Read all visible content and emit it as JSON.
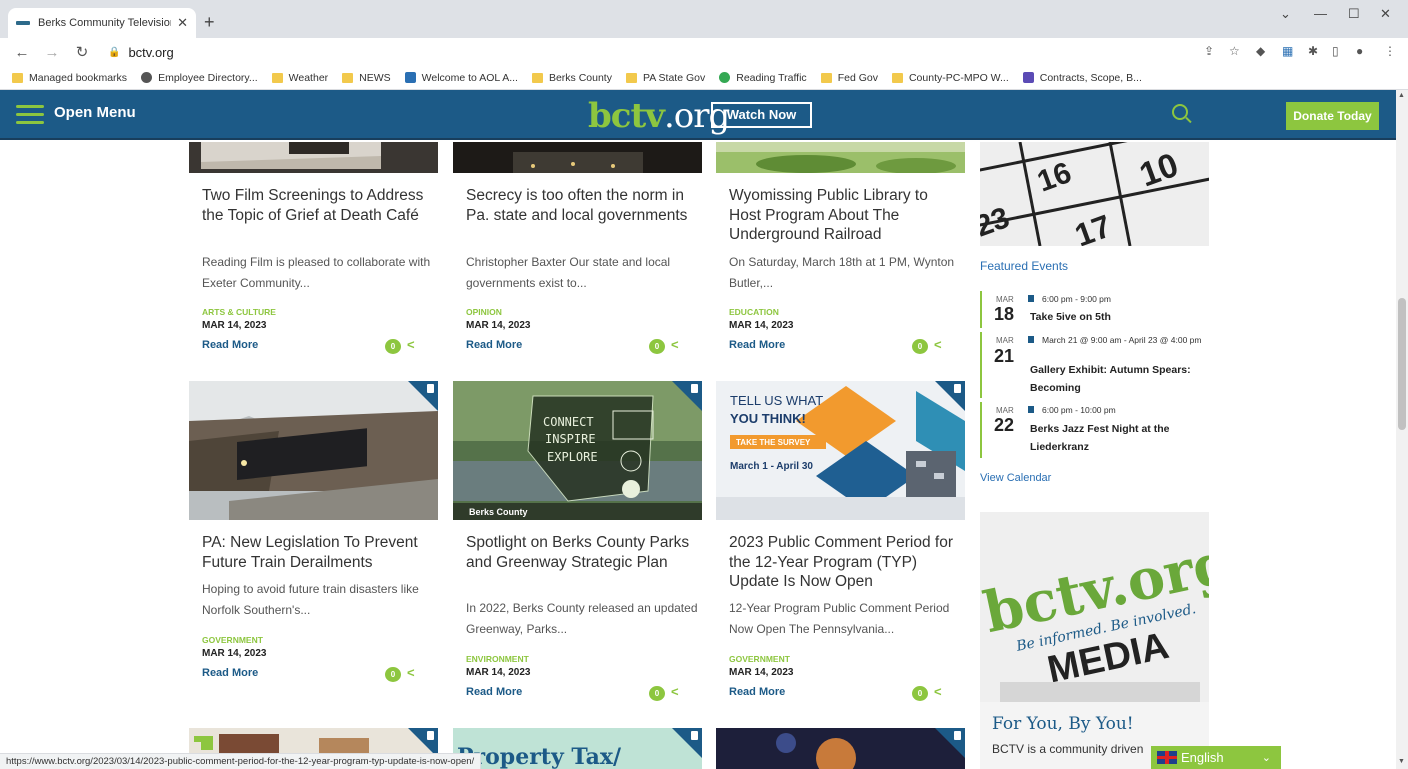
{
  "browser": {
    "tab_title": "Berks Community Television | Be",
    "url": "bctv.org",
    "bookmarks": [
      {
        "label": "Managed bookmarks",
        "type": "folder"
      },
      {
        "label": "Employee Directory...",
        "type": "site"
      },
      {
        "label": "Weather",
        "type": "folder"
      },
      {
        "label": "NEWS",
        "type": "folder"
      },
      {
        "label": "Welcome to AOL A...",
        "type": "site"
      },
      {
        "label": "Berks County",
        "type": "folder"
      },
      {
        "label": "PA State Gov",
        "type": "folder"
      },
      {
        "label": "Reading Traffic",
        "type": "site"
      },
      {
        "label": "Fed Gov",
        "type": "folder"
      },
      {
        "label": "County-PC-MPO W...",
        "type": "folder"
      },
      {
        "label": "Contracts, Scope, B...",
        "type": "site"
      }
    ],
    "status_url": "https://www.bctv.org/2023/03/14/2023-public-comment-period-for-the-12-year-program-typ-update-is-now-open/"
  },
  "header": {
    "menu_label": "Open Menu",
    "logo_main": "bctv",
    "logo_suffix": ".org",
    "watch_now": "Watch Now",
    "donate": "Donate Today"
  },
  "articles": [
    {
      "title": "Two Film Screenings to Address the Topic of Grief at Death Café",
      "excerpt": "Reading Film is pleased to collaborate with Exeter Community...",
      "category": "ARTS & CULTURE",
      "date": "MAR 14, 2023",
      "read_more": "Read More",
      "comments": "0"
    },
    {
      "title": "Secrecy is too often the norm in Pa. state and local governments",
      "excerpt": "Christopher Baxter Our state and local governments exist to...",
      "category": "OPINION",
      "date": "MAR 14, 2023",
      "read_more": "Read More",
      "comments": "0"
    },
    {
      "title": "Wyomissing Public Library to Host Program About The Underground Railroad",
      "excerpt": "On Saturday, March 18th at 1 PM, Wynton Butler,...",
      "category": "EDUCATION",
      "date": "MAR 14, 2023",
      "read_more": "Read More",
      "comments": "0"
    },
    {
      "title": "PA: New Legislation To Prevent Future Train Derailments",
      "excerpt": "Hoping to avoid future train disasters like Norfolk Southern's...",
      "category": "GOVERNMENT",
      "date": "MAR 14, 2023",
      "read_more": "Read More",
      "comments": "0"
    },
    {
      "title": "Spotlight on Berks County Parks and Greenway Strategic Plan",
      "excerpt": "In 2022, Berks County released an updated Greenway, Parks...",
      "category": "ENVIRONMENT",
      "date": "MAR 14, 2023",
      "read_more": "Read More",
      "comments": "0",
      "image_text": [
        "CONNECT",
        "INSPIRE",
        "EXPLORE",
        "Berks County"
      ]
    },
    {
      "title": "2023 Public Comment Period for the 12-Year Program (TYP) Update Is Now Open",
      "excerpt": "12-Year Program Public Comment Period Now Open The Pennsylvania...",
      "category": "GOVERNMENT",
      "date": "MAR 14, 2023",
      "read_more": "Read More",
      "comments": "0",
      "image_text": [
        "TELL US WHAT",
        "YOU THINK!",
        "TAKE THE SURVEY",
        "March 1 - April 30"
      ]
    }
  ],
  "next_row": {
    "middle_image_text": "Property Tax/"
  },
  "sidebar": {
    "calendar_numbers": [
      "16",
      "10",
      "23",
      "17"
    ],
    "featured_title": "Featured Events",
    "events": [
      {
        "month": "MAR",
        "day": "18",
        "time": "6:00 pm - 9:00 pm",
        "name": "Take 5ive on 5th"
      },
      {
        "month": "MAR",
        "day": "21",
        "time": "March 21 @ 9:00 am - April 23 @ 4:00 pm",
        "name": "Gallery Exhibit: Autumn Spears: Becoming"
      },
      {
        "month": "MAR",
        "day": "22",
        "time": "6:00 pm - 10:00 pm",
        "name": "Berks Jazz Fest Night at the Liederkranz"
      }
    ],
    "view_calendar": "View Calendar",
    "media_logo": "bctv.org",
    "media_tagline": "Be informed. Be involved.",
    "media_word": "MEDIA",
    "foryou_title": "For You, By You!",
    "foryou_text": "BCTV is a community driven"
  },
  "language": {
    "label": "English"
  },
  "colors": {
    "brand_blue": "#1c5a87",
    "brand_green": "#8dc63f",
    "link_blue": "#2a6fb3"
  }
}
